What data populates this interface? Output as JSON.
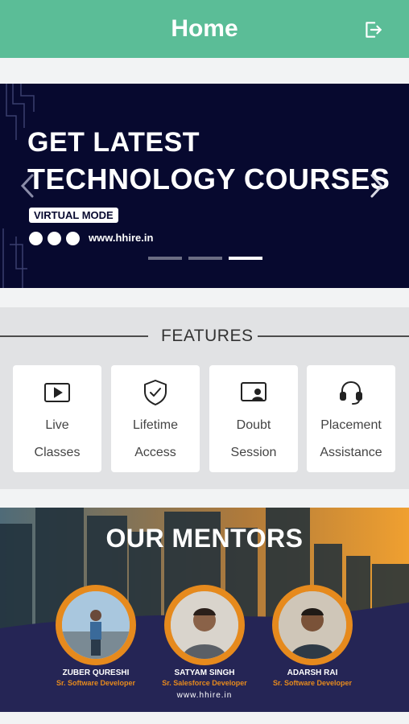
{
  "header": {
    "title": "Home",
    "logout_icon": "logout-icon",
    "color": "#5bbd97"
  },
  "banner": {
    "line1": "GET LATEST",
    "line2": "TECHNOLOGY COURSES",
    "chip": "VIRTUAL MODE",
    "website": "www.hhire.in",
    "contact_icons": [
      "phone-icon",
      "globe-icon",
      "mail-icon"
    ],
    "prev_icon": "chevron-left-icon",
    "next_icon": "chevron-right-icon",
    "slide_count": 3,
    "active_slide": 3,
    "background": "#07092f"
  },
  "features": {
    "heading": "FEATURES",
    "items": [
      {
        "line1": "Live",
        "line2": "Classes",
        "icon": "play-icon"
      },
      {
        "line1": "Lifetime",
        "line2": "Access",
        "icon": "shield-check-icon"
      },
      {
        "line1": "Doubt",
        "line2": "Session",
        "icon": "video-call-icon"
      },
      {
        "line1": "Placement",
        "line2": "Assistance",
        "icon": "headset-icon"
      }
    ]
  },
  "mentors": {
    "title": "OUR MENTORS",
    "website": "www.hhire.in",
    "accent": "#e68a1d",
    "people": [
      {
        "name": "ZUBER QURESHI",
        "role": "Sr. Software Developer"
      },
      {
        "name": "SATYAM SINGH",
        "role": "Sr. Salesforce Developer"
      },
      {
        "name": "ADARSH RAI",
        "role": "Sr. Software Developer"
      }
    ]
  }
}
